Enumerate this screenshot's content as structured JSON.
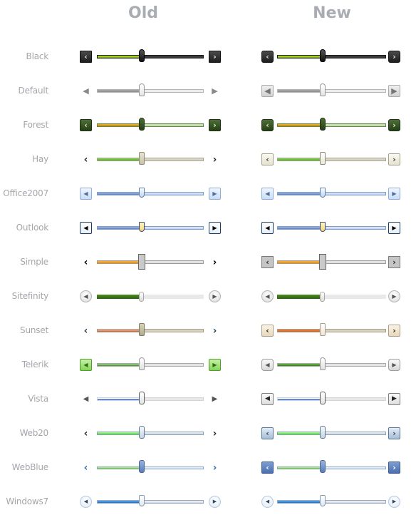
{
  "headers": {
    "old": "Old",
    "new": "New"
  },
  "arrows": {
    "left": "‹",
    "right": "›",
    "left_tri": "◀",
    "right_tri": "▶"
  },
  "slider_value_percent": 42,
  "skins": [
    {
      "id": "black",
      "label": "Black",
      "old_arrow": "chevron",
      "new_arrow": "chevron"
    },
    {
      "id": "default",
      "label": "Default",
      "old_arrow": "triangle",
      "new_arrow": "triangle"
    },
    {
      "id": "forest",
      "label": "Forest",
      "old_arrow": "chevron",
      "new_arrow": "chevron"
    },
    {
      "id": "hay",
      "label": "Hay",
      "old_arrow": "chevron",
      "new_arrow": "chevron"
    },
    {
      "id": "office2007",
      "label": "Office2007",
      "old_arrow": "triangle",
      "new_arrow": "triangle"
    },
    {
      "id": "outlook",
      "label": "Outlook",
      "old_arrow": "triangle",
      "new_arrow": "triangle"
    },
    {
      "id": "simple",
      "label": "Simple",
      "old_arrow": "chevron",
      "new_arrow": "chevron"
    },
    {
      "id": "sitefinity",
      "label": "Sitefinity",
      "old_arrow": "triangle",
      "new_arrow": "triangle"
    },
    {
      "id": "sunset",
      "label": "Sunset",
      "old_arrow": "chevron",
      "new_arrow": "chevron"
    },
    {
      "id": "telerik",
      "label": "Telerik",
      "old_arrow": "triangle",
      "new_arrow": "triangle"
    },
    {
      "id": "vista",
      "label": "Vista",
      "old_arrow": "triangle",
      "new_arrow": "triangle"
    },
    {
      "id": "web20",
      "label": "Web20",
      "old_arrow": "chevron",
      "new_arrow": "chevron"
    },
    {
      "id": "webblue",
      "label": "WebBlue",
      "old_arrow": "chevron",
      "new_arrow": "chevron"
    },
    {
      "id": "windows7",
      "label": "Windows7",
      "old_arrow": "triangle",
      "new_arrow": "triangle"
    }
  ]
}
